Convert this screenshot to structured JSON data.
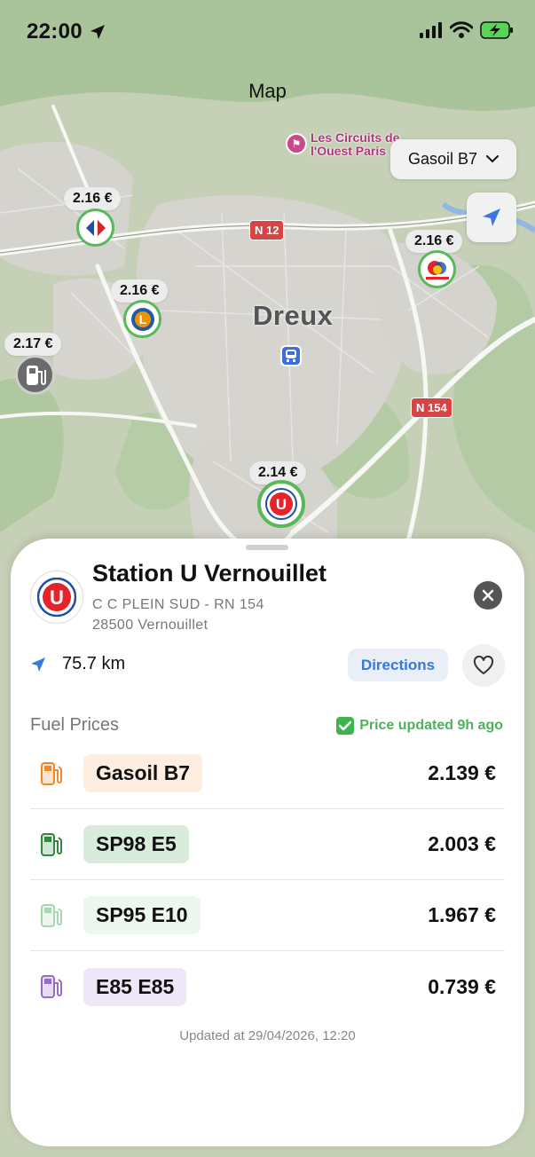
{
  "status_bar": {
    "time": "22:00"
  },
  "map": {
    "title": "Map",
    "poi_label_line1": "Les Circuits de",
    "poi_label_line2": "l'Ouest Paris",
    "fuel_type_selector": "Gasoil B7",
    "city_label": "Dreux",
    "road_labels": [
      "N 12",
      "N 154"
    ],
    "markers": [
      {
        "price": "2.16 €",
        "brand": "carrefour"
      },
      {
        "price": "2.16 €",
        "brand": "leclerc"
      },
      {
        "price": "2.17 €",
        "brand": "generic-pump"
      },
      {
        "price": "2.16 €",
        "brand": "totalenergies"
      },
      {
        "price": "2.14 €",
        "brand": "station-u"
      }
    ]
  },
  "station": {
    "name": "Station U Vernouillet",
    "address_line1": "C C PLEIN SUD - RN 154",
    "address_line2": "28500 Vernouillet",
    "distance": "75.7 km",
    "directions_label": "Directions"
  },
  "prices": {
    "section_title": "Fuel Prices",
    "updated_badge": "Price updated 9h ago",
    "rows": [
      {
        "fuel": "Gasoil B7",
        "price": "2.139 €",
        "color": "#f0882c",
        "chip_bg": "#fdeee0"
      },
      {
        "fuel": "SP98 E5",
        "price": "2.003 €",
        "color": "#2e8a40",
        "chip_bg": "#d9ecdc"
      },
      {
        "fuel": "SP95 E10",
        "price": "1.967 €",
        "color": "#a6d8ad",
        "chip_bg": "#eef7ef"
      },
      {
        "fuel": "E85 E85",
        "price": "0.739 €",
        "color": "#9a69c9",
        "chip_bg": "#efe7f7"
      }
    ],
    "footer": "Updated at 29/04/2026, 12:20"
  }
}
